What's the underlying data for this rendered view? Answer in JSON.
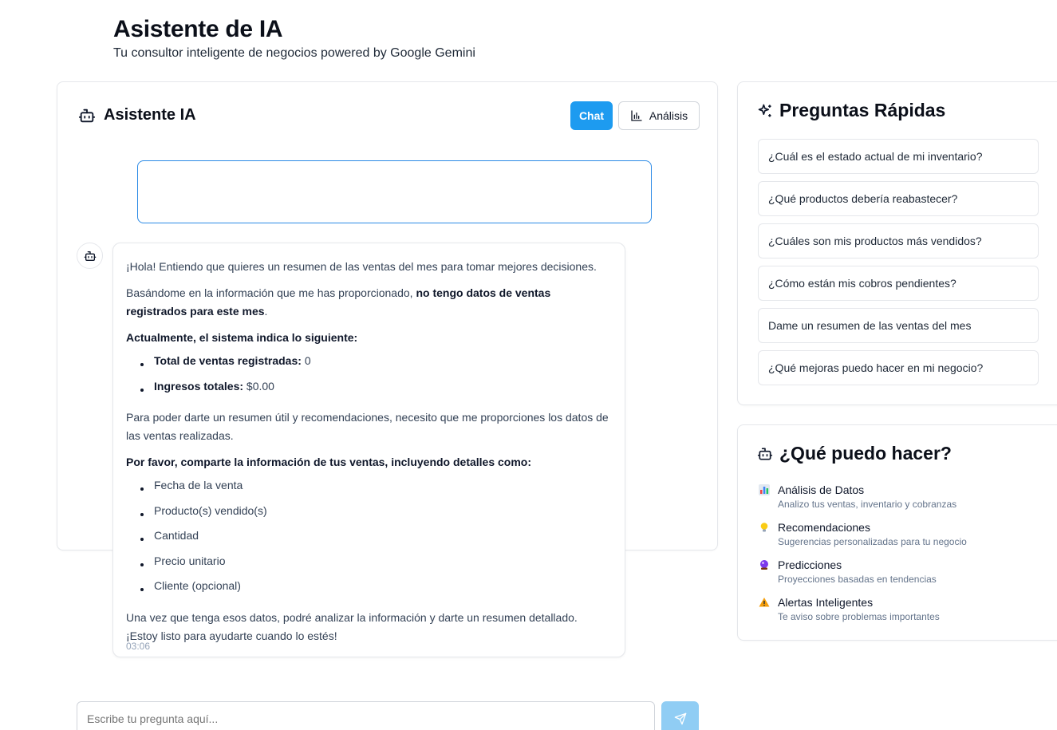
{
  "header": {
    "title": "Asistente de IA",
    "subtitle": "Tu consultor inteligente de negocios powered by Google Gemini"
  },
  "chat_panel": {
    "title": "Asistente IA",
    "tabs": [
      {
        "label": "Chat",
        "active": true
      },
      {
        "label": "Análisis",
        "active": false
      }
    ],
    "message": {
      "greeting": "¡Hola! Entiendo que quieres un resumen de las ventas del mes para tomar mejores decisiones.",
      "p2_prefix": "Basándome en la información que me has proporcionado, ",
      "p2_bold": "no tengo datos de ventas registrados para este mes",
      "p2_suffix": ".",
      "status_heading": "Actualmente, el sistema indica lo siguiente:",
      "status_items": [
        {
          "label": "Total de ventas registradas:",
          "value": "0"
        },
        {
          "label": "Ingresos totales:",
          "value": "$0.00"
        }
      ],
      "p3": "Para poder darte un resumen útil y recomendaciones, necesito que me proporciones los datos de las ventas realizadas.",
      "request_heading": "Por favor, comparte la información de tus ventas, incluyendo detalles como:",
      "request_items": [
        "Fecha de la venta",
        "Producto(s) vendido(s)",
        "Cantidad",
        "Precio unitario",
        "Cliente (opcional)"
      ],
      "closing": "Una vez que tenga esos datos, podré analizar la información y darte un resumen detallado. ¡Estoy listo para ayudarte cuando lo estés!",
      "time": "03:06"
    },
    "input_placeholder": "Escribe tu pregunta aquí..."
  },
  "quick_questions": {
    "title": "Preguntas Rápidas",
    "items": [
      "¿Cuál es el estado actual de mi inventario?",
      "¿Qué productos debería reabastecer?",
      "¿Cuáles son mis productos más vendidos?",
      "¿Cómo están mis cobros pendientes?",
      "Dame un resumen de las ventas del mes",
      "¿Qué mejoras puedo hacer en mi negocio?"
    ]
  },
  "capabilities": {
    "title": "¿Qué puedo hacer?",
    "items": [
      {
        "icon": "bar-chart-emoji",
        "name": "Análisis de Datos",
        "desc": "Analizo tus ventas, inventario y cobranzas"
      },
      {
        "icon": "lightbulb-emoji",
        "name": "Recomendaciones",
        "desc": "Sugerencias personalizadas para tu negocio"
      },
      {
        "icon": "crystal-ball-emoji",
        "name": "Predicciones",
        "desc": "Proyecciones basadas en tendencias"
      },
      {
        "icon": "warning-emoji",
        "name": "Alertas Inteligentes",
        "desc": "Te aviso sobre problemas importantes"
      }
    ]
  },
  "colors": {
    "accent": "#1d9bf0",
    "send_disabled": "#90cdf4",
    "border": "#e5e7eb"
  }
}
